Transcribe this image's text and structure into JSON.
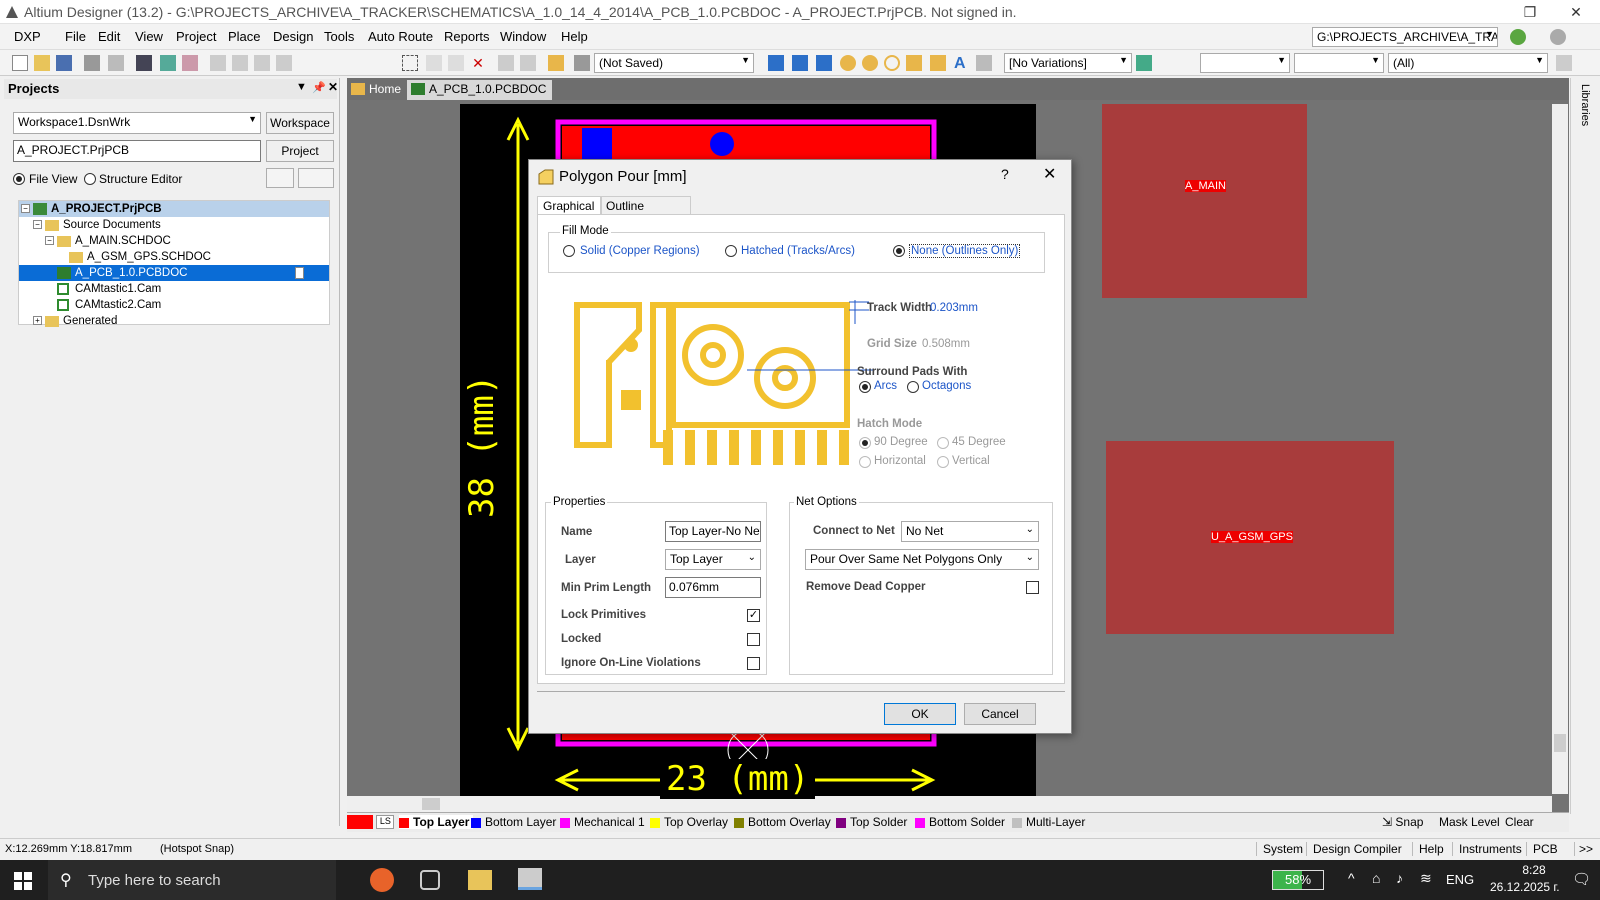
{
  "window": {
    "title": "Altium Designer (13.2) - G:\\PROJECTS_ARCHIVE\\A_TRACKER\\SCHEMATICS\\A_1.0_14_4_2014\\A_PCB_1.0.PCBDOC - A_PROJECT.PrjPCB. Not signed in.",
    "restore": "❐",
    "minimize": "—",
    "close": "✕"
  },
  "menu": [
    "DXP",
    "File",
    "Edit",
    "View",
    "Project",
    "Place",
    "Design",
    "Tools",
    "Auto Route",
    "Reports",
    "Window",
    "Help"
  ],
  "path_combo": "G:\\PROJECTS_ARCHIVE\\A_TRACKE",
  "toolbar": {
    "save_state": "(Not Saved)",
    "variations": "[No Variations]",
    "filter": "(All)"
  },
  "projects_panel": {
    "title": "Projects",
    "workspace_value": "Workspace1.DsnWrk",
    "workspace_button": "Workspace",
    "project_value": "A_PROJECT.PrjPCB",
    "project_button": "Project",
    "view_file": "File View",
    "view_structure": "Structure Editor",
    "tree": [
      {
        "label": "A_PROJECT.PrjPCB",
        "level": 0,
        "toggle": "−"
      },
      {
        "label": "Source Documents",
        "level": 1,
        "toggle": "−"
      },
      {
        "label": "A_MAIN.SCHDOC",
        "level": 2,
        "toggle": "−"
      },
      {
        "label": "A_GSM_GPS.SCHDOC",
        "level": 3,
        "toggle": ""
      },
      {
        "label": "A_PCB_1.0.PCBDOC",
        "level": 2,
        "toggle": ""
      },
      {
        "label": "CAMtastic1.Cam",
        "level": 2,
        "toggle": ""
      },
      {
        "label": "CAMtastic2.Cam",
        "level": 2,
        "toggle": ""
      },
      {
        "label": "Generated",
        "level": 1,
        "toggle": "+"
      }
    ]
  },
  "doc_tabs": [
    "Home",
    "A_PCB_1.0.PCBDOC"
  ],
  "libraries_tab": "Libraries",
  "pcb": {
    "dim_vertical": "38 (mm)",
    "dim_horizontal": "23 (mm)",
    "comp1": "A_MAIN",
    "comp2": "U_A_GSM_GPS"
  },
  "dialog": {
    "title": "Polygon Pour [mm]",
    "help": "?",
    "close": "✕",
    "tabs": [
      "Graphical",
      "Outline Vertices"
    ],
    "fill_mode": {
      "legend": "Fill Mode",
      "options": [
        "Solid (Copper Regions)",
        "Hatched (Tracks/Arcs)",
        "None (Outlines Only)"
      ],
      "selected": "None (Outlines Only)"
    },
    "track_width_label": "Track Width",
    "track_width": "0.203mm",
    "grid_size_label": "Grid Size",
    "grid_size": "0.508mm",
    "surround_label": "Surround Pads With",
    "surround_options": [
      "Arcs",
      "Octagons"
    ],
    "hatch_label": "Hatch Mode",
    "hatch_options": [
      "90 Degree",
      "45 Degree",
      "Horizontal",
      "Vertical"
    ],
    "properties": {
      "legend": "Properties",
      "name_label": "Name",
      "name_value": "Top Layer-No Net",
      "layer_label": "Layer",
      "layer_value": "Top Layer",
      "min_prim_label": "Min Prim Length",
      "min_prim_value": "0.076mm",
      "lock_primitives_label": "Lock Primitives",
      "lock_primitives": true,
      "locked_label": "Locked",
      "locked": false,
      "ignore_label": "Ignore On-Line Violations",
      "ignore": false
    },
    "net_options": {
      "legend": "Net Options",
      "connect_label": "Connect to Net",
      "connect_value": "No Net",
      "pour_value": "Pour Over Same Net Polygons Only",
      "remove_dead_label": "Remove Dead Copper",
      "remove_dead": false
    },
    "ok": "OK",
    "cancel": "Cancel"
  },
  "layers": [
    {
      "label": "Top Layer",
      "color": "#ff0000"
    },
    {
      "label": "Bottom Layer",
      "color": "#0000ff"
    },
    {
      "label": "Mechanical 1",
      "color": "#ff00ff"
    },
    {
      "label": "Top Overlay",
      "color": "#ffff00"
    },
    {
      "label": "Bottom Overlay",
      "color": "#808000"
    },
    {
      "label": "Top Solder",
      "color": "#800080"
    },
    {
      "label": "Bottom Solder",
      "color": "#ff00ff"
    },
    {
      "label": "Multi-Layer",
      "color": "#c0c0c0"
    }
  ],
  "layer_ls": "LS",
  "layer_right": [
    "Snap",
    "Mask Level",
    "Clear"
  ],
  "status": {
    "coords": "X:12.269mm Y:18.817mm",
    "snap": "(Hotspot Snap)",
    "panels": [
      "System",
      "Design Compiler",
      "Help",
      "Instruments",
      "PCB",
      ">>"
    ]
  },
  "taskbar": {
    "search": "Type here to search",
    "battery": "58%",
    "lang": "ENG",
    "time": "8:28",
    "date": "26.12.2025 г."
  }
}
